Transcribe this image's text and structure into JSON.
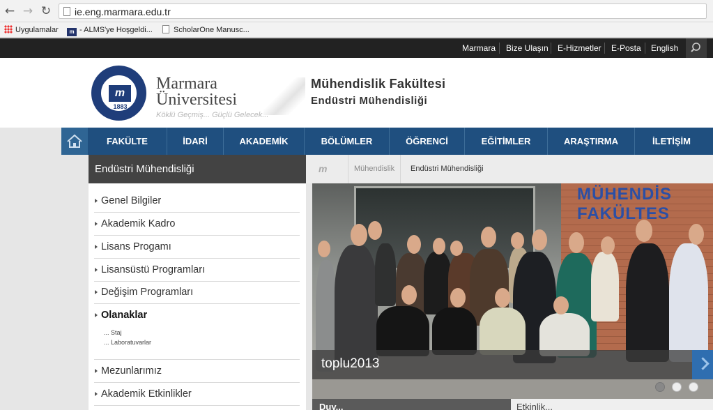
{
  "browser": {
    "url": "ie.eng.marmara.edu.tr",
    "bookmarks": [
      {
        "label": "Uygulamalar",
        "icon": "apps-grid-icon"
      },
      {
        "label": "- ALMS'ye Hoşgeldi...",
        "icon": "marmara-logo-icon"
      },
      {
        "label": "ScholarOne Manusc...",
        "icon": "page-icon"
      }
    ]
  },
  "topbar": {
    "links": [
      "Marmara",
      "Bize Ulaşın",
      "E-Hizmetler",
      "E-Posta",
      "English"
    ],
    "search_icon": "search-icon"
  },
  "header": {
    "seal_year": "1883",
    "university_line1": "Marmara",
    "university_line2": "Üniversitesi",
    "slogan": "Köklü Geçmiş... Güçlü Gelecek...",
    "faculty": "Mühendislik Fakültesi",
    "department": "Endüstri Mühendisliği"
  },
  "mainnav": {
    "home_icon": "home-icon",
    "items": [
      "FAKÜLTE",
      "İDARİ",
      "AKADEMİK",
      "BÖLÜMLER",
      "ÖĞRENCİ",
      "EĞİTİMLER",
      "ARAŞTIRMA",
      "İLETİŞİM"
    ]
  },
  "sidebar": {
    "heading": "Endüstri Mühendisliği",
    "items": [
      "Genel Bilgiler",
      "Akademik Kadro",
      "Lisans Progamı",
      "Lisansüstü Programları",
      "Değişim Programları",
      "Olanaklar",
      "Mezunlarımız",
      "Akademik Etkinlikler"
    ],
    "subitems": [
      "... Staj",
      "... Laboratuvarlar"
    ]
  },
  "breadcrumb": {
    "items": [
      "Mühendislik",
      "Endüstri Mühendisliği"
    ]
  },
  "slider": {
    "caption": "toplu2013",
    "building_sign_line1": "MÜHENDİS",
    "building_sign_line2": "FAKÜLTES",
    "slide_count": 3,
    "active_slide": 1
  },
  "bottom": {
    "left_label": "Duy...",
    "right_label": "Etkinlik..."
  },
  "colors": {
    "nav_blue": "#1f4f7f",
    "topbar": "#222222",
    "sidebar_head": "#434343"
  }
}
